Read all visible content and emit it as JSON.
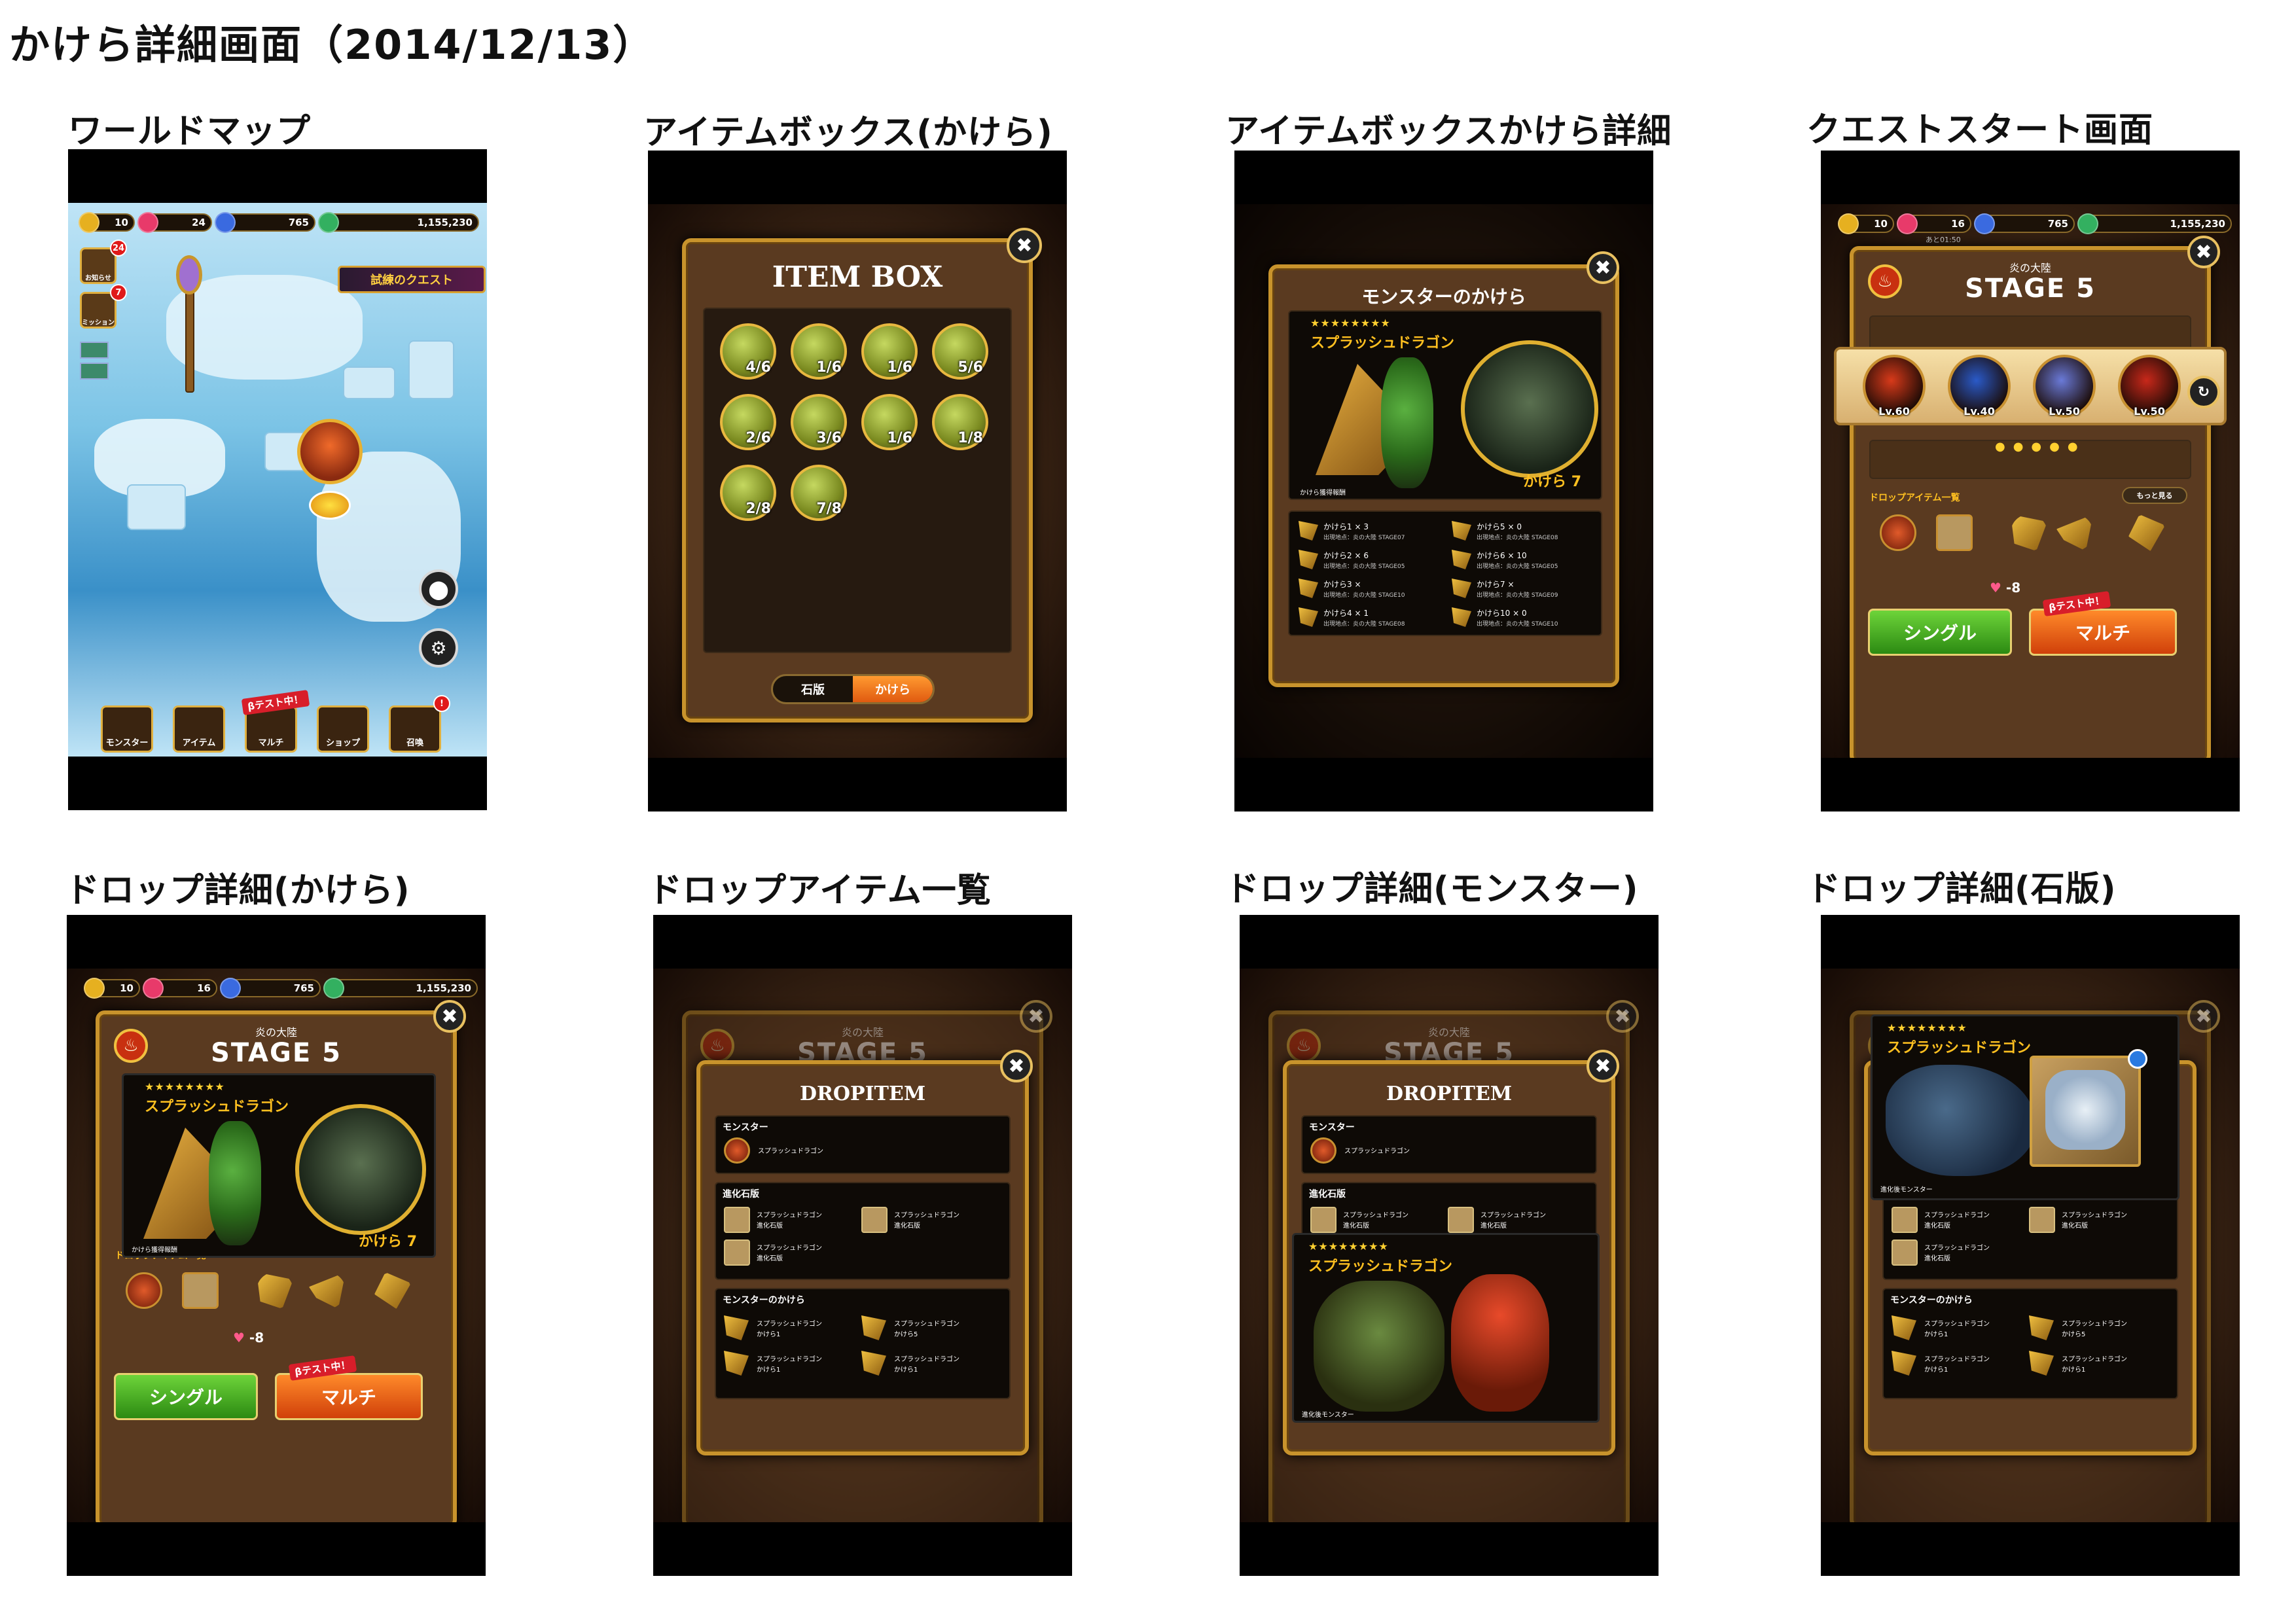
{
  "document_title": "かけら詳細画面（2014/12/13）",
  "screens": {
    "world_map": {
      "label": "ワールドマップ"
    },
    "item_box": {
      "label": "アイテムボックス(かけら)"
    },
    "item_box_detail": {
      "label": "アイテムボックスかけら詳細"
    },
    "quest_start": {
      "label": "クエストスタート画面"
    },
    "drop_detail_kakera": {
      "label": "ドロップ詳細(かけら)"
    },
    "drop_item_list": {
      "label": "ドロップアイテム一覧"
    },
    "drop_detail_monster": {
      "label": "ドロップ詳細(モンスター)"
    },
    "drop_detail_stone": {
      "label": "ドロップ詳細(石版)"
    }
  },
  "hud": {
    "rank": "10",
    "life_map": "24",
    "life": "16",
    "life_max": "24",
    "stone": "765",
    "gold": "1,155,230",
    "timer": "あと01:50"
  },
  "world_map": {
    "news_label": "お知らせ",
    "news_badge": "24",
    "mission_label": "ミッション",
    "mission_badge": "7",
    "trial_banner": "試練のクエスト",
    "nav": [
      {
        "label": "モンスター"
      },
      {
        "label": "アイテム"
      },
      {
        "label": "マルチ"
      },
      {
        "label": "ショップ"
      },
      {
        "label": "召喚"
      }
    ],
    "beta_tag": "βテスト中！",
    "nav_badge": "!"
  },
  "item_box": {
    "title": "ITEM BOX",
    "items": [
      "4/6",
      "1/6",
      "1/6",
      "5/6",
      "2/6",
      "3/6",
      "1/6",
      "1/8",
      "2/8",
      "7/8"
    ],
    "tab_stone": "石版",
    "tab_kakera": "かけら",
    "close": "✖"
  },
  "kakera_detail": {
    "title": "モンスターのかけら",
    "stars": "★★★★★★★★",
    "monster_name": "スプラッシュドラゴン",
    "count_label": "かけら 7",
    "caption": "かけら獲得報酬",
    "rewards": [
      {
        "name": "かけら1 × 3",
        "place": "出現地点：炎の大陸 STAGE07"
      },
      {
        "name": "かけら5 × 0",
        "place": "出現地点：炎の大陸 STAGE08"
      },
      {
        "name": "かけら2 × 6",
        "place": "出現地点：炎の大陸 STAGE05"
      },
      {
        "name": "かけら6 × 10",
        "place": "出現地点：炎の大陸 STAGE05"
      },
      {
        "name": "かけら3 ×",
        "place": "出現地点：炎の大陸 STAGE10"
      },
      {
        "name": "かけら7 ×",
        "place": "出現地点：炎の大陸 STAGE09"
      },
      {
        "name": "かけら4 × 1",
        "place": "出現地点：炎の大陸 STAGE08"
      },
      {
        "name": "かけら10 × 0",
        "place": "出現地点：炎の大陸 STAGE10"
      }
    ]
  },
  "quest": {
    "continent": "炎の大陸",
    "stage": "STAGE 5",
    "party": [
      {
        "level": "Lv.60"
      },
      {
        "level": "Lv.40"
      },
      {
        "level": "Lv.50"
      },
      {
        "level": "Lv.50"
      }
    ],
    "drop_heading": "ドロップアイテム一覧",
    "more_button": "もっと見る",
    "stamina_cost": "-8",
    "single_button": "シングル",
    "multi_button": "マルチ",
    "beta_tag": "βテスト中！"
  },
  "dropitem": {
    "title": "DROPITEM",
    "monster_heading": "モンスター",
    "monster_name": "スプラッシュドラゴン",
    "stone_heading": "進化石版",
    "stone_items": [
      {
        "name": "スプラッシュドラゴン",
        "sub": "進化石版"
      },
      {
        "name": "スプラッシュドラゴン",
        "sub": "進化石版"
      },
      {
        "name": "スプラッシュドラゴン",
        "sub": "進化石版"
      }
    ],
    "kakera_heading": "モンスターのかけら",
    "kakera_items": [
      {
        "name": "スプラッシュドラゴン",
        "sub": "かけら1"
      },
      {
        "name": "スプラッシュドラゴン",
        "sub": "かけら5"
      },
      {
        "name": "スプラッシュドラゴン",
        "sub": "かけら1"
      },
      {
        "name": "スプラッシュドラゴン",
        "sub": "かけら1"
      }
    ],
    "evolved_label": "進化後モンスター"
  },
  "colors": {
    "frame_gold": "#c8932c",
    "panel_dark": "#261a10",
    "single_green": "#3ca41c",
    "multi_orange": "#e8601a",
    "beta_red": "#d81e2a",
    "star_yellow": "#ffd030"
  }
}
